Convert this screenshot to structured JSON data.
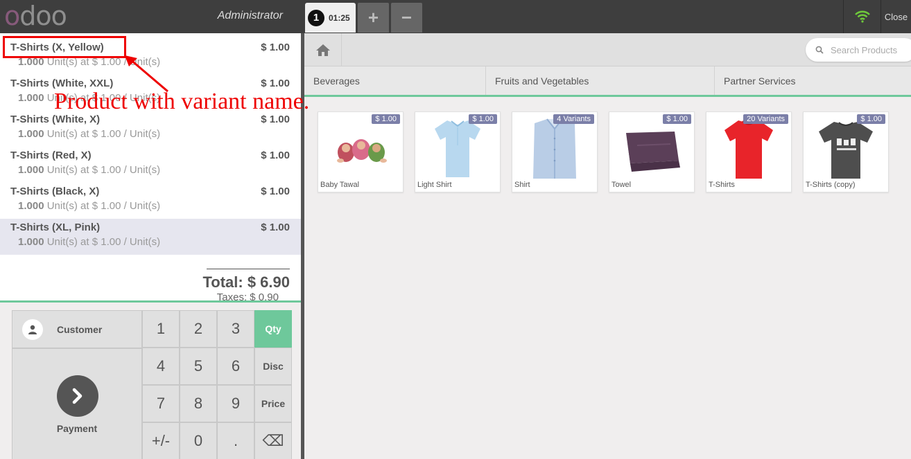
{
  "topbar": {
    "logo": "odoo",
    "cashier": "Administrator",
    "order_number": "1",
    "order_time": "01:25",
    "add_label": "+",
    "remove_label": "−",
    "close_label": "Close"
  },
  "orderlines": [
    {
      "name": "T-Shirts (X, Yellow)",
      "price": "$ 1.00",
      "qty": "1.000",
      "unit_info": " Unit(s) at $ 1.00 / Unit(s)"
    },
    {
      "name": "T-Shirts (White, XXL)",
      "price": "$ 1.00",
      "qty": "1.000",
      "unit_info": " Unit(s) at $ 1.00 / Unit(s)"
    },
    {
      "name": "T-Shirts (White, X)",
      "price": "$ 1.00",
      "qty": "1.000",
      "unit_info": " Unit(s) at $ 1.00 / Unit(s)"
    },
    {
      "name": "T-Shirts (Red, X)",
      "price": "$ 1.00",
      "qty": "1.000",
      "unit_info": " Unit(s) at $ 1.00 / Unit(s)"
    },
    {
      "name": "T-Shirts (Black, X)",
      "price": "$ 1.00",
      "qty": "1.000",
      "unit_info": " Unit(s) at $ 1.00 / Unit(s)"
    },
    {
      "name": "T-Shirts (XL, Pink)",
      "price": "$ 1.00",
      "qty": "1.000",
      "unit_info": " Unit(s) at $ 1.00 / Unit(s)"
    }
  ],
  "summary": {
    "total": "Total: $ 6.90",
    "taxes": "Taxes: $ 0.90"
  },
  "controls": {
    "customer_label": "Customer",
    "payment_label": "Payment",
    "keys": [
      "1",
      "2",
      "3",
      "Qty",
      "4",
      "5",
      "6",
      "Disc",
      "7",
      "8",
      "9",
      "Price",
      "+/-",
      "0",
      ".",
      "⌫"
    ]
  },
  "search": {
    "placeholder": "Search Products"
  },
  "categories": [
    "Beverages",
    "Fruits and Vegetables",
    "Partner Services"
  ],
  "products": [
    {
      "name": "Baby Tawal",
      "badge": "$ 1.00"
    },
    {
      "name": "Light Shirt",
      "badge": "$ 1.00"
    },
    {
      "name": "Shirt",
      "badge": "4 Variants"
    },
    {
      "name": "Towel",
      "badge": "$ 1.00"
    },
    {
      "name": "T-Shirts",
      "badge": "20 Variants"
    },
    {
      "name": "T-Shirts (copy)",
      "badge": "$ 1.00"
    }
  ],
  "annotation": {
    "text": "Product with variant name."
  },
  "colors": {
    "accent": "#6ec89b",
    "annotation": "#e00000",
    "badge": "#7b7fa8",
    "topbar": "#3e3e3e"
  }
}
